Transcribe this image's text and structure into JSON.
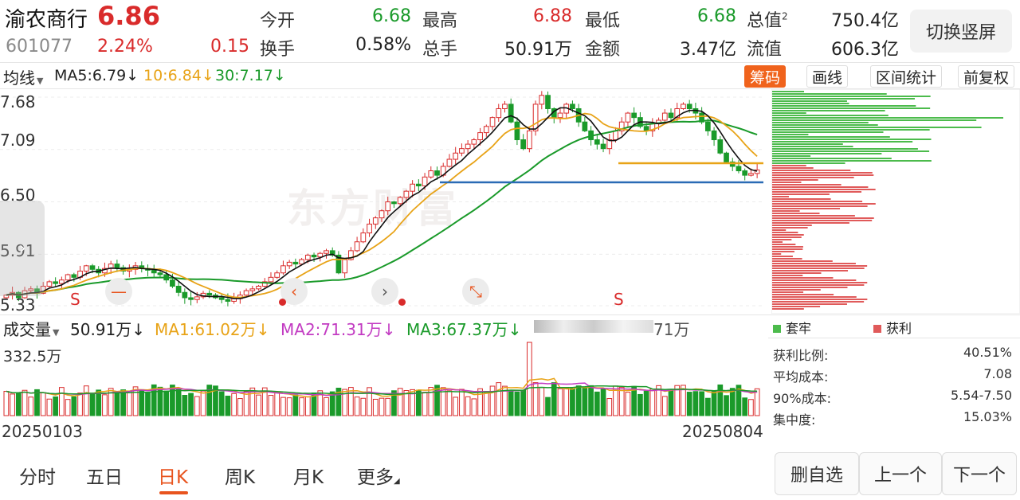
{
  "header": {
    "stock_name": "渝农商行",
    "last_price": "6.86",
    "stock_code": "601077",
    "change_pct": "2.24%",
    "change_amt": "0.15",
    "quotes": [
      {
        "label": "今开",
        "value": "6.68",
        "color": "green"
      },
      {
        "label": "最高",
        "value": "6.88",
        "color": "red"
      },
      {
        "label": "最低",
        "value": "6.68",
        "color": "green"
      },
      {
        "label": "总值",
        "value": "750.4亿",
        "color": "dark",
        "sup": "2"
      },
      {
        "label": "换手",
        "value": "0.58%",
        "color": "dark"
      },
      {
        "label": "总手",
        "value": "50.91万",
        "color": "dark"
      },
      {
        "label": "金额",
        "value": "3.47亿",
        "color": "dark"
      },
      {
        "label": "流值",
        "value": "606.3亿",
        "color": "dark"
      }
    ],
    "switch_button": "切换竖屏"
  },
  "indicators": {
    "ma_select": "均线",
    "ma5": "MA5:6.79",
    "ma10": "10:6.84",
    "ma30": "30:7.17",
    "arrow": "↓",
    "colors": {
      "ma5": "#111111",
      "ma10": "#e8a317",
      "ma30": "#1a9a2a"
    }
  },
  "tools": {
    "chip": "筹码",
    "draw": "画线",
    "range_stats": "区间统计",
    "adjust": "前复权"
  },
  "price_axis": {
    "labels": [
      "7.68",
      "7.09",
      "6.50",
      "5.91",
      "5.33"
    ]
  },
  "markers": {
    "s_label": "S",
    "minus": "—",
    "prev": "‹",
    "next": "›",
    "shrink": "⤡",
    "handle": "›"
  },
  "watermark": "东方财富",
  "volume": {
    "select": "成交量",
    "value": "50.91万",
    "ma1": "MA1:61.02万",
    "ma2": "MA2:71.31万",
    "ma3": "MA3:67.37万",
    "tail": "71万",
    "arrow": "↓",
    "max_label": "332.5万",
    "date_start": "20250103",
    "date_end": "20250804",
    "colors": {
      "ma1": "#e8a317",
      "ma2": "#c23bc2",
      "ma3": "#1a9a2a"
    }
  },
  "chips": {
    "legend_trapped": "套牢",
    "legend_profit": "获利",
    "stats": [
      {
        "label": "获利比例:",
        "value": "40.51%"
      },
      {
        "label": "平均成本:",
        "value": "7.08"
      },
      {
        "label": "90%成本:",
        "value": "5.54-7.50"
      },
      {
        "label": "集中度:",
        "value": "15.03%"
      }
    ],
    "colors": {
      "trapped": "#4cbb4c",
      "profit": "#e05a5a"
    }
  },
  "periods": [
    "分时",
    "五日",
    "日K",
    "周K",
    "月K",
    "更多"
  ],
  "active_period": "日K",
  "bottom_buttons": {
    "delete": "删自选",
    "prev": "上一个",
    "next": "下一个"
  },
  "chart_data": {
    "type": "candlestick",
    "x_range": [
      "20250103",
      "20250804"
    ],
    "ylim": [
      5.33,
      7.68
    ],
    "closes": [
      5.45,
      5.48,
      5.42,
      5.5,
      5.52,
      5.47,
      5.55,
      5.6,
      5.58,
      5.62,
      5.68,
      5.65,
      5.72,
      5.78,
      5.74,
      5.7,
      5.75,
      5.8,
      5.76,
      5.72,
      5.74,
      5.78,
      5.75,
      5.73,
      5.7,
      5.68,
      5.62,
      5.55,
      5.48,
      5.42,
      5.4,
      5.43,
      5.47,
      5.45,
      5.42,
      5.4,
      5.38,
      5.41,
      5.45,
      5.5,
      5.52,
      5.55,
      5.6,
      5.65,
      5.7,
      5.78,
      5.82,
      5.8,
      5.85,
      5.9,
      5.88,
      5.92,
      5.95,
      5.9,
      5.7,
      5.85,
      5.95,
      6.05,
      6.15,
      6.25,
      6.32,
      6.4,
      6.5,
      6.48,
      6.55,
      6.62,
      6.7,
      6.68,
      6.78,
      6.85,
      6.8,
      6.9,
      6.98,
      7.05,
      7.1,
      7.15,
      7.2,
      7.28,
      7.35,
      7.45,
      7.55,
      7.6,
      7.4,
      7.2,
      7.1,
      7.3,
      7.6,
      7.7,
      7.55,
      7.45,
      7.5,
      7.6,
      7.55,
      7.4,
      7.3,
      7.2,
      7.15,
      7.1,
      7.2,
      7.3,
      7.4,
      7.5,
      7.45,
      7.35,
      7.3,
      7.38,
      7.42,
      7.5,
      7.45,
      7.55,
      7.6,
      7.55,
      7.5,
      7.4,
      7.3,
      7.2,
      7.05,
      6.95,
      6.9,
      6.85,
      6.8,
      6.82,
      6.86
    ],
    "volume_note": "bars aligned with candles"
  }
}
